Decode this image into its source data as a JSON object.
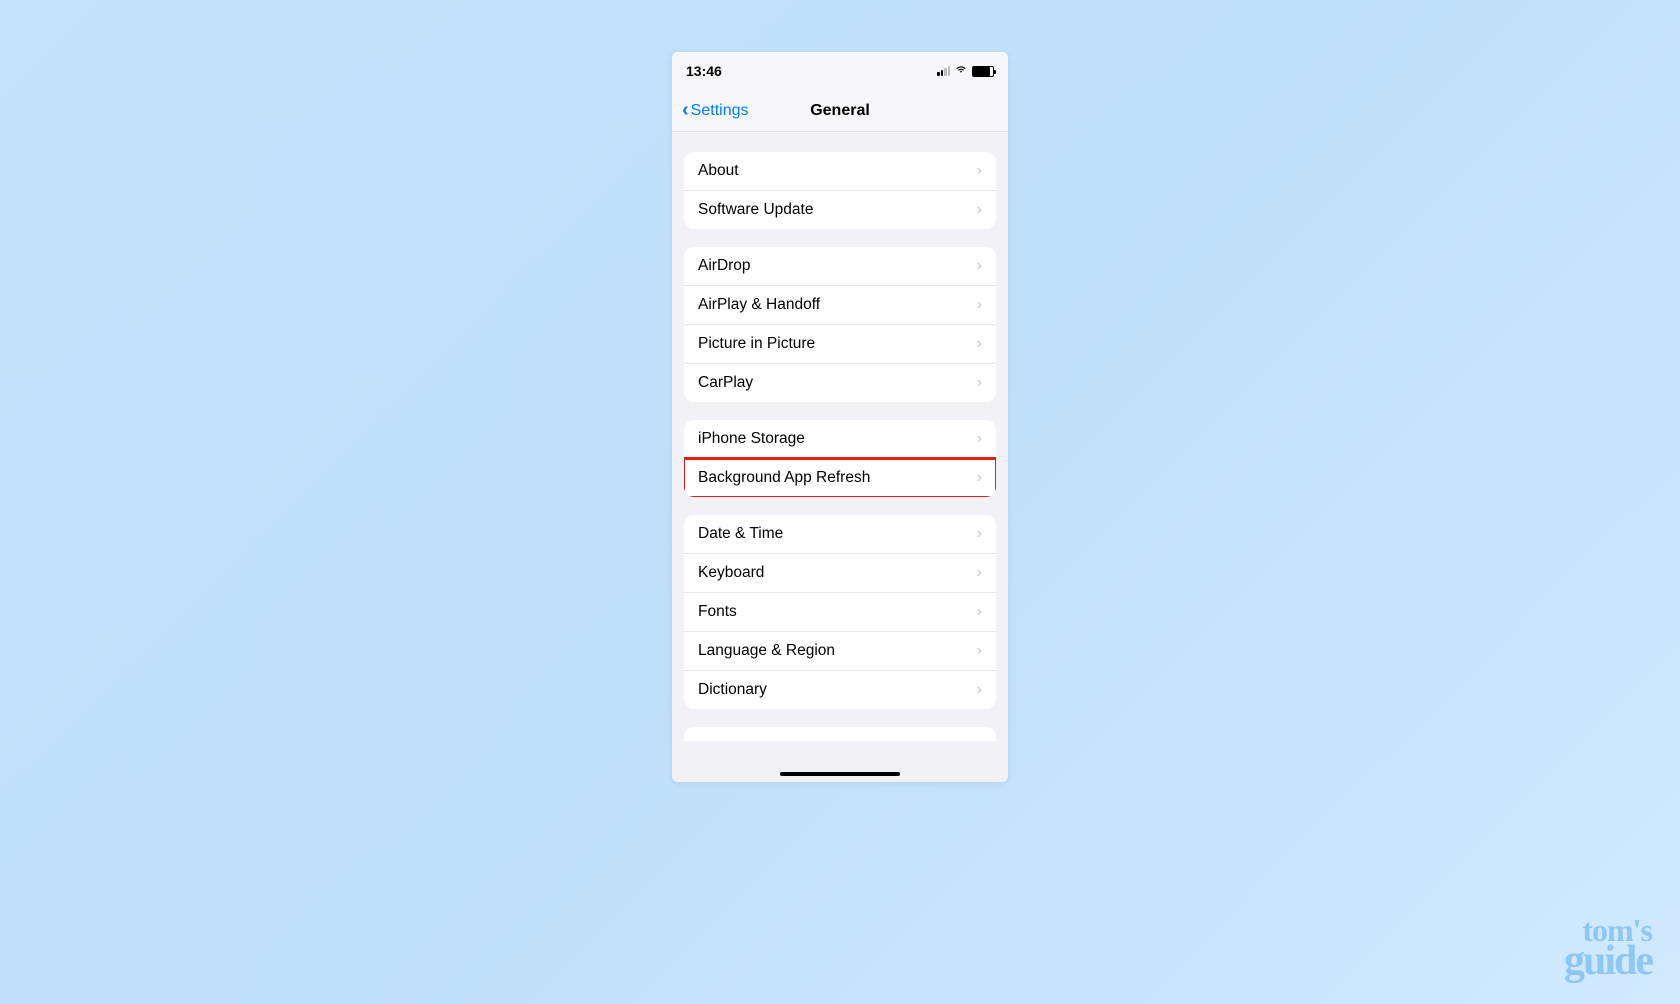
{
  "status": {
    "time": "13:46"
  },
  "nav": {
    "back_label": "Settings",
    "title": "General"
  },
  "sections": [
    {
      "id": "section-info",
      "rows": [
        {
          "id": "about",
          "label": "About",
          "highlighted": false
        },
        {
          "id": "software-update",
          "label": "Software Update",
          "highlighted": false
        }
      ]
    },
    {
      "id": "section-connectivity",
      "rows": [
        {
          "id": "airdrop",
          "label": "AirDrop",
          "highlighted": false
        },
        {
          "id": "airplay-handoff",
          "label": "AirPlay & Handoff",
          "highlighted": false
        },
        {
          "id": "picture-in-picture",
          "label": "Picture in Picture",
          "highlighted": false
        },
        {
          "id": "carplay",
          "label": "CarPlay",
          "highlighted": false
        }
      ]
    },
    {
      "id": "section-storage",
      "rows": [
        {
          "id": "iphone-storage",
          "label": "iPhone Storage",
          "highlighted": false
        },
        {
          "id": "background-app-refresh",
          "label": "Background App Refresh",
          "highlighted": true
        }
      ]
    },
    {
      "id": "section-system",
      "rows": [
        {
          "id": "date-time",
          "label": "Date & Time",
          "highlighted": false
        },
        {
          "id": "keyboard",
          "label": "Keyboard",
          "highlighted": false
        },
        {
          "id": "fonts",
          "label": "Fonts",
          "highlighted": false
        },
        {
          "id": "language-region",
          "label": "Language & Region",
          "highlighted": false
        },
        {
          "id": "dictionary",
          "label": "Dictionary",
          "highlighted": false
        }
      ]
    }
  ],
  "watermark": {
    "line1": "tom's",
    "line2": "guide"
  }
}
